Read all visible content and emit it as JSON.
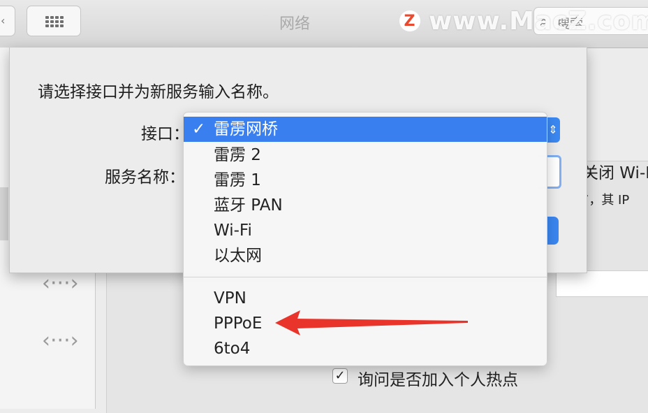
{
  "toolbar": {
    "title": "网络",
    "search_placeholder": "搜索",
    "watermark_logo": "Z",
    "watermark_text": "www.MacZ.com"
  },
  "sheet": {
    "prompt": "请选择接口并为新服务输入名称。",
    "interface_label": "接口：",
    "service_name_label": "服务名称："
  },
  "background": {
    "partial_text_1": "关闭 Wi-F",
    "partial_text_2": "”，其 IP",
    "checkbox_label": "询问是否加入个人热点"
  },
  "menu": {
    "checkmark": "✓",
    "items": [
      {
        "label": "雷雳网桥",
        "selected": true
      },
      {
        "label": "雷雳 2"
      },
      {
        "label": "雷雳 1"
      },
      {
        "label": "蓝牙 PAN"
      },
      {
        "label": "Wi-Fi"
      },
      {
        "label": "以太网"
      }
    ],
    "vpn_items": [
      {
        "label": "VPN"
      },
      {
        "label": "PPPoE"
      },
      {
        "label": "6to4"
      }
    ]
  },
  "icons": {
    "service_icon": "‹···›",
    "checkbox_check": "✓",
    "search": "⌕"
  },
  "colors": {
    "accent": "#3a7ff0",
    "arrow": "#e8342a"
  }
}
